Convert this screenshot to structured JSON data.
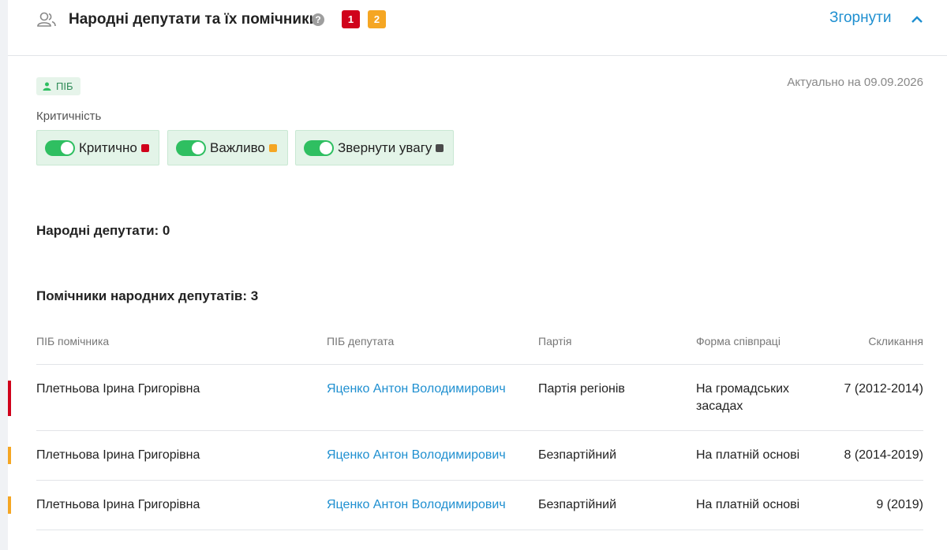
{
  "header": {
    "title": "Народні депутати та їх помічники",
    "help": "?",
    "badges": [
      "1",
      "2"
    ],
    "collapse_label": "Згорнути"
  },
  "filter": {
    "pib_tag": "ПІБ",
    "actual": "Актуально на 09.09.2026",
    "criticality_label": "Критичність",
    "toggles": [
      {
        "label": "Критично",
        "color": "#d0021b"
      },
      {
        "label": "Важливо",
        "color": "#f5a623"
      },
      {
        "label": "Звернути увагу",
        "color": "#4a4a4a"
      }
    ]
  },
  "deputies_title": "Народні депутати: 0",
  "assistants": {
    "title": "Помічники народних депутатів: 3",
    "columns": [
      "ПІБ помічника",
      "ПІБ депутата",
      "Партія",
      "Форма співпраці",
      "Скликання"
    ],
    "rows": [
      {
        "assistant": "Плетньова Ірина Григорівна",
        "deputy": "Яценко Антон Володимирович",
        "party": "Партія регіонів",
        "form": "На громадських засадах",
        "convocation": "7 (2012-2014)",
        "marker": "#d0021b"
      },
      {
        "assistant": "Плетньова Ірина Григорівна",
        "deputy": "Яценко Антон Володимирович",
        "party": "Безпартійний",
        "form": "На платній основі",
        "convocation": "8 (2014-2019)",
        "marker": "#f5a623"
      },
      {
        "assistant": "Плетньова Ірина Григорівна",
        "deputy": "Яценко Антон Володимирович",
        "party": "Безпартійний",
        "form": "На платній основі",
        "convocation": "9 (2019)",
        "marker": "#f5a623"
      }
    ]
  }
}
